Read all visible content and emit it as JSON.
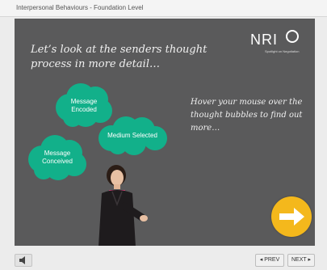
{
  "window": {
    "title": "Interpersonal Behaviours - Foundation Level"
  },
  "slide": {
    "heading": "Let’s look at the senders thought process in more detail…",
    "logo": {
      "text": "NRI",
      "tagline": "Spotlight on Negotiation"
    },
    "bubbles": [
      {
        "label_line1": "Message",
        "label_line2": "Encoded"
      },
      {
        "label_line1": "Medium Selected",
        "label_line2": ""
      },
      {
        "label_line1": "Message",
        "label_line2": "Conceived"
      }
    ],
    "instruction": "Hover your mouse over the thought bubbles to find out more…",
    "colors": {
      "bubble": "#12b08a",
      "slide_bg": "#5a5a5b",
      "next_arrow": "#f4b81c"
    }
  },
  "footer": {
    "audio_icon": "speaker-icon",
    "prev_label": "◂ PREV",
    "next_label": "NEXT ▸"
  }
}
